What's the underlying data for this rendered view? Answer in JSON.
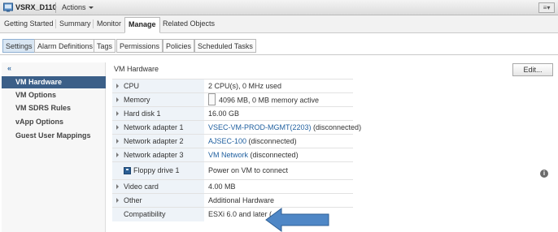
{
  "title_bar": {
    "vm_name": "VSRX_D110",
    "actions_label": "Actions",
    "menu_icon": "list-icon"
  },
  "main_tabs": [
    {
      "label": "Getting Started"
    },
    {
      "label": "Summary"
    },
    {
      "label": "Monitor"
    },
    {
      "label": "Manage",
      "active": true
    },
    {
      "label": "Related Objects"
    }
  ],
  "sub_tabs": [
    {
      "label": "Settings",
      "active": true
    },
    {
      "label": "Alarm Definitions"
    },
    {
      "label": "Tags"
    },
    {
      "label": "Permissions"
    },
    {
      "label": "Policies"
    },
    {
      "label": "Scheduled Tasks"
    }
  ],
  "left_nav": {
    "collapse_label": "«",
    "items": [
      {
        "label": "VM Hardware",
        "active": true
      },
      {
        "label": "VM Options"
      },
      {
        "label": "VM SDRS Rules"
      },
      {
        "label": "vApp Options"
      },
      {
        "label": "Guest User Mappings"
      }
    ]
  },
  "panel": {
    "title": "VM Hardware",
    "edit_label": "Edit..."
  },
  "hardware": [
    {
      "label": "CPU",
      "value": "2 CPU(s), 0 MHz used"
    },
    {
      "label": "Memory",
      "value": "4096 MB, 0 MB memory active"
    },
    {
      "label": "Hard disk 1",
      "value": "16.00 GB"
    },
    {
      "label": "Network adapter 1",
      "link": "VSEC-VM-PROD-MGMT(2203)",
      "value": "(disconnected)"
    },
    {
      "label": "Network adapter 2",
      "link": "AJSEC-100",
      "value": "(disconnected)"
    },
    {
      "label": "Network adapter 3",
      "link": "VM Network",
      "value": "(disconnected)"
    },
    {
      "label": "Floppy drive 1",
      "value": "Power on VM to connect"
    },
    {
      "label": "Video card",
      "value": "4.00 MB"
    },
    {
      "label": "Other",
      "value": "Additional Hardware"
    },
    {
      "label": "Compatibility",
      "value": "ESXi 6.0 and later (…"
    }
  ],
  "annotation_color": "#4f87c6"
}
